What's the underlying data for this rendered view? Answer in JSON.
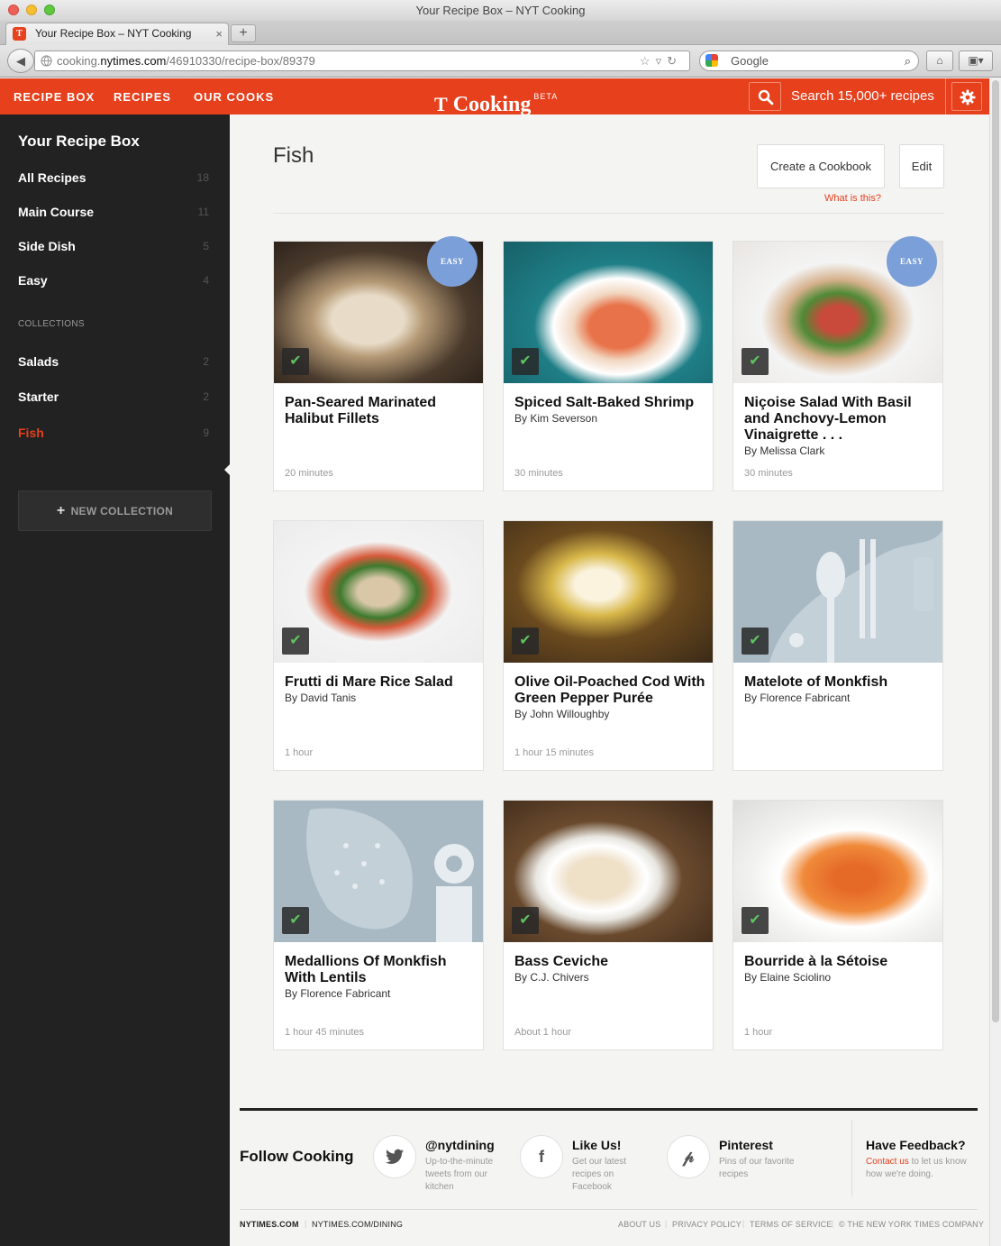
{
  "window": {
    "title": "Your Recipe Box – NYT Cooking"
  },
  "tab": {
    "label": "Your Recipe Box – NYT Cooking",
    "close": "×",
    "new_tab": "+"
  },
  "addressbar": {
    "url_prefix": "cooking.",
    "url_domain": "nytimes.com",
    "url_path": "/46910330/recipe-box/89379",
    "search_placeholder": "Google"
  },
  "header": {
    "nav": [
      "RECIPE BOX",
      "RECIPES",
      "OUR COOKS"
    ],
    "logo_mark": "T",
    "logo_text": "Cooking",
    "logo_beta": "BETA",
    "search_text": "Search 15,000+ recipes"
  },
  "sidebar": {
    "title": "Your Recipe Box",
    "items": [
      {
        "label": "All Recipes",
        "count": "18"
      },
      {
        "label": "Main Course",
        "count": "11"
      },
      {
        "label": "Side Dish",
        "count": "5"
      },
      {
        "label": "Easy",
        "count": "4"
      }
    ],
    "collections_label": "COLLECTIONS",
    "collections": [
      {
        "label": "Salads",
        "count": "2"
      },
      {
        "label": "Starter",
        "count": "2"
      },
      {
        "label": "Fish",
        "count": "9"
      }
    ],
    "new_collection": "NEW COLLECTION"
  },
  "main": {
    "title": "Fish",
    "create_button": "Create a Cookbook",
    "edit_button": "Edit",
    "what_is_this": "What is this?",
    "easy_badge": "EASY",
    "cards": [
      {
        "title": "Pan-Seared Marinated Halibut Fillets",
        "author": "",
        "time": "20 minutes",
        "easy": true
      },
      {
        "title": "Spiced Salt-Baked Shrimp",
        "author": "By Kim Severson",
        "time": "30 minutes",
        "easy": false
      },
      {
        "title": "Niçoise Salad With Basil and Anchovy-Lemon Vinaigrette . . .",
        "author": "By Melissa Clark",
        "time": "30 minutes",
        "easy": true
      },
      {
        "title": "Frutti di Mare Rice Salad",
        "author": "By David Tanis",
        "time": "1 hour",
        "easy": false
      },
      {
        "title": "Olive Oil-Poached Cod With Green Pepper Purée",
        "author": "By John Willoughby",
        "time": "1 hour 15 minutes",
        "easy": false
      },
      {
        "title": "Matelote of Monkfish",
        "author": "By Florence Fabricant",
        "time": "",
        "easy": false
      },
      {
        "title": "Medallions Of Monkfish With Lentils",
        "author": "By Florence Fabricant",
        "time": "1 hour 45 minutes",
        "easy": false
      },
      {
        "title": "Bass Ceviche",
        "author": "By C.J. Chivers",
        "time": "About 1 hour",
        "easy": false
      },
      {
        "title": "Bourride à la Sétoise",
        "author": "By Elaine Sciolino",
        "time": "1 hour",
        "easy": false
      }
    ]
  },
  "footer": {
    "follow": "Follow Cooking",
    "social": [
      {
        "title": "@nytdining",
        "desc": "Up-to-the-minute tweets from our kitchen"
      },
      {
        "title": "Like Us!",
        "desc": "Get our latest recipes on Facebook"
      },
      {
        "title": "Pinterest",
        "desc": "Pins of our favorite recipes"
      }
    ],
    "feedback_title": "Have Feedback?",
    "feedback_link": "Contact us",
    "feedback_rest": " to let us know how we're doing.",
    "links_left": [
      "NYTIMES.COM",
      "NYTIMES.COM/DINING"
    ],
    "links_right": [
      "ABOUT US",
      "PRIVACY POLICY",
      "TERMS OF SERVICE",
      "© THE NEW YORK TIMES COMPANY"
    ]
  }
}
